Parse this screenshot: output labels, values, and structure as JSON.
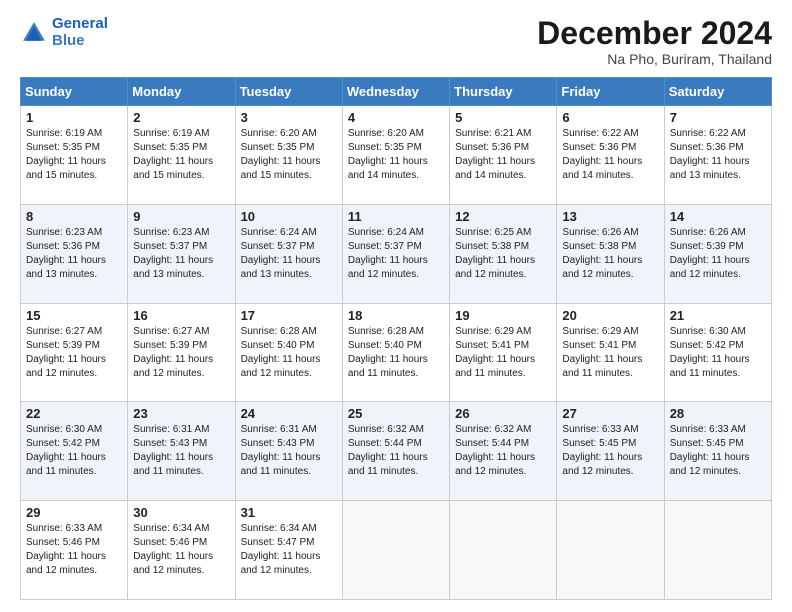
{
  "header": {
    "logo_line1": "General",
    "logo_line2": "Blue",
    "title": "December 2024",
    "location": "Na Pho, Buriram, Thailand"
  },
  "weekdays": [
    "Sunday",
    "Monday",
    "Tuesday",
    "Wednesday",
    "Thursday",
    "Friday",
    "Saturday"
  ],
  "weeks": [
    [
      {
        "day": "1",
        "sunrise": "6:19 AM",
        "sunset": "5:35 PM",
        "daylight": "11 hours and 15 minutes."
      },
      {
        "day": "2",
        "sunrise": "6:19 AM",
        "sunset": "5:35 PM",
        "daylight": "11 hours and 15 minutes."
      },
      {
        "day": "3",
        "sunrise": "6:20 AM",
        "sunset": "5:35 PM",
        "daylight": "11 hours and 15 minutes."
      },
      {
        "day": "4",
        "sunrise": "6:20 AM",
        "sunset": "5:35 PM",
        "daylight": "11 hours and 14 minutes."
      },
      {
        "day": "5",
        "sunrise": "6:21 AM",
        "sunset": "5:36 PM",
        "daylight": "11 hours and 14 minutes."
      },
      {
        "day": "6",
        "sunrise": "6:22 AM",
        "sunset": "5:36 PM",
        "daylight": "11 hours and 14 minutes."
      },
      {
        "day": "7",
        "sunrise": "6:22 AM",
        "sunset": "5:36 PM",
        "daylight": "11 hours and 13 minutes."
      }
    ],
    [
      {
        "day": "8",
        "sunrise": "6:23 AM",
        "sunset": "5:36 PM",
        "daylight": "11 hours and 13 minutes."
      },
      {
        "day": "9",
        "sunrise": "6:23 AM",
        "sunset": "5:37 PM",
        "daylight": "11 hours and 13 minutes."
      },
      {
        "day": "10",
        "sunrise": "6:24 AM",
        "sunset": "5:37 PM",
        "daylight": "11 hours and 13 minutes."
      },
      {
        "day": "11",
        "sunrise": "6:24 AM",
        "sunset": "5:37 PM",
        "daylight": "11 hours and 12 minutes."
      },
      {
        "day": "12",
        "sunrise": "6:25 AM",
        "sunset": "5:38 PM",
        "daylight": "11 hours and 12 minutes."
      },
      {
        "day": "13",
        "sunrise": "6:26 AM",
        "sunset": "5:38 PM",
        "daylight": "11 hours and 12 minutes."
      },
      {
        "day": "14",
        "sunrise": "6:26 AM",
        "sunset": "5:39 PM",
        "daylight": "11 hours and 12 minutes."
      }
    ],
    [
      {
        "day": "15",
        "sunrise": "6:27 AM",
        "sunset": "5:39 PM",
        "daylight": "11 hours and 12 minutes."
      },
      {
        "day": "16",
        "sunrise": "6:27 AM",
        "sunset": "5:39 PM",
        "daylight": "11 hours and 12 minutes."
      },
      {
        "day": "17",
        "sunrise": "6:28 AM",
        "sunset": "5:40 PM",
        "daylight": "11 hours and 12 minutes."
      },
      {
        "day": "18",
        "sunrise": "6:28 AM",
        "sunset": "5:40 PM",
        "daylight": "11 hours and 11 minutes."
      },
      {
        "day": "19",
        "sunrise": "6:29 AM",
        "sunset": "5:41 PM",
        "daylight": "11 hours and 11 minutes."
      },
      {
        "day": "20",
        "sunrise": "6:29 AM",
        "sunset": "5:41 PM",
        "daylight": "11 hours and 11 minutes."
      },
      {
        "day": "21",
        "sunrise": "6:30 AM",
        "sunset": "5:42 PM",
        "daylight": "11 hours and 11 minutes."
      }
    ],
    [
      {
        "day": "22",
        "sunrise": "6:30 AM",
        "sunset": "5:42 PM",
        "daylight": "11 hours and 11 minutes."
      },
      {
        "day": "23",
        "sunrise": "6:31 AM",
        "sunset": "5:43 PM",
        "daylight": "11 hours and 11 minutes."
      },
      {
        "day": "24",
        "sunrise": "6:31 AM",
        "sunset": "5:43 PM",
        "daylight": "11 hours and 11 minutes."
      },
      {
        "day": "25",
        "sunrise": "6:32 AM",
        "sunset": "5:44 PM",
        "daylight": "11 hours and 11 minutes."
      },
      {
        "day": "26",
        "sunrise": "6:32 AM",
        "sunset": "5:44 PM",
        "daylight": "11 hours and 12 minutes."
      },
      {
        "day": "27",
        "sunrise": "6:33 AM",
        "sunset": "5:45 PM",
        "daylight": "11 hours and 12 minutes."
      },
      {
        "day": "28",
        "sunrise": "6:33 AM",
        "sunset": "5:45 PM",
        "daylight": "11 hours and 12 minutes."
      }
    ],
    [
      {
        "day": "29",
        "sunrise": "6:33 AM",
        "sunset": "5:46 PM",
        "daylight": "11 hours and 12 minutes."
      },
      {
        "day": "30",
        "sunrise": "6:34 AM",
        "sunset": "5:46 PM",
        "daylight": "11 hours and 12 minutes."
      },
      {
        "day": "31",
        "sunrise": "6:34 AM",
        "sunset": "5:47 PM",
        "daylight": "11 hours and 12 minutes."
      },
      null,
      null,
      null,
      null
    ]
  ],
  "labels": {
    "sunrise": "Sunrise:",
    "sunset": "Sunset:",
    "daylight": "Daylight:"
  }
}
